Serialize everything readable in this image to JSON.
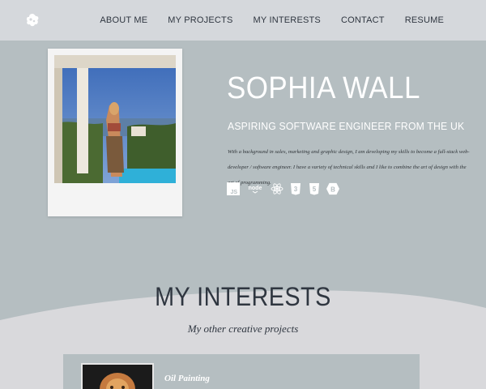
{
  "nav": {
    "logo_icon": "blob-logo-icon",
    "links": [
      "ABOUT ME",
      "MY PROJECTS",
      "MY INTERESTS",
      "CONTACT",
      "RESUME"
    ]
  },
  "hero": {
    "name": "SOPHIA WALL",
    "tagline": "ASPIRING SOFTWARE ENGINEER FROM THE UK",
    "bio": "With a background in sales, marketing and graphic design, I am developing my skills to become a full-stack web-developer / software engineer. I have a variety of technical skills and I like to combine the art of design with the art of programming.",
    "tech_icons": [
      {
        "name": "js-icon",
        "label": "JS"
      },
      {
        "name": "nodejs-icon",
        "label": "node"
      },
      {
        "name": "react-icon",
        "label": ""
      },
      {
        "name": "css3-icon",
        "label": "3"
      },
      {
        "name": "html5-icon",
        "label": "5"
      },
      {
        "name": "bootstrap-icon",
        "label": "B"
      }
    ]
  },
  "interests": {
    "title": "MY INTERESTS",
    "subtitle": "My other creative projects",
    "cards": [
      {
        "title": "Oil Painting"
      }
    ]
  },
  "colors": {
    "hero_bg": "#b5bec1",
    "nav_bg": "#d5d8dc",
    "page_bg": "#d9d9dc",
    "text_dark": "#2f3640"
  }
}
